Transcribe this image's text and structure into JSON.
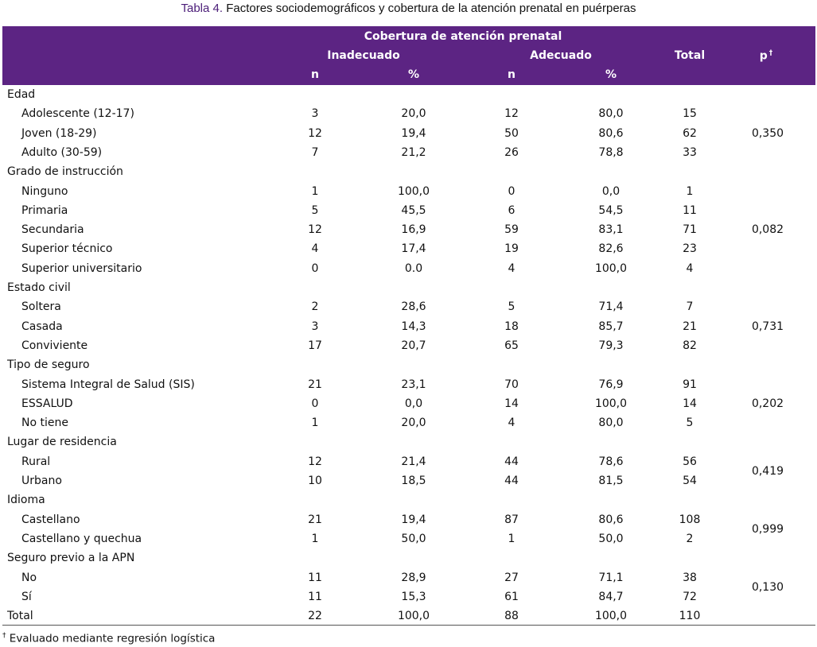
{
  "caption": {
    "label": "Tabla 4.",
    "text": " Factores sociodemográficos y cobertura de la atención prenatal en puérperas"
  },
  "header": {
    "group": "Cobertura de atención prenatal",
    "inadecuado": "Inadecuado",
    "adecuado": "Adecuado",
    "total": "Total",
    "p": "p",
    "p_mark": "†",
    "n": "n",
    "pct": "%"
  },
  "rows": [
    {
      "type": "section",
      "label": "Edad"
    },
    {
      "type": "row",
      "label": "Adolescente (12-17)",
      "n1": "3",
      "p1": "20,0",
      "n2": "12",
      "p2": "80,0",
      "total": "15"
    },
    {
      "type": "row",
      "label": "Joven  (18-29)",
      "n1": "12",
      "p1": "19,4",
      "n2": "50",
      "p2": "80,6",
      "total": "62",
      "pval": "0,350"
    },
    {
      "type": "row",
      "label": "Adulto (30-59)",
      "n1": "7",
      "p1": "21,2",
      "n2": "26",
      "p2": "78,8",
      "total": "33"
    },
    {
      "type": "section",
      "label": "Grado de instrucción"
    },
    {
      "type": "row",
      "label": "Ninguno",
      "n1": "1",
      "p1": "100,0",
      "n2": "0",
      "p2": "0,0",
      "total": "1"
    },
    {
      "type": "row",
      "label": "Primaria",
      "n1": "5",
      "p1": "45,5",
      "n2": "6",
      "p2": "54,5",
      "total": "11"
    },
    {
      "type": "row",
      "label": "Secundaria",
      "n1": "12",
      "p1": "16,9",
      "n2": "59",
      "p2": "83,1",
      "total": "71",
      "pval": "0,082"
    },
    {
      "type": "row",
      "label": "Superior técnico",
      "n1": "4",
      "p1": "17,4",
      "n2": "19",
      "p2": "82,6",
      "total": "23"
    },
    {
      "type": "row",
      "label": "Superior universitario",
      "n1": "0",
      "p1": "0.0",
      "n2": "4",
      "p2": "100,0",
      "total": "4"
    },
    {
      "type": "section",
      "label": "Estado civil"
    },
    {
      "type": "row",
      "label": "Soltera",
      "n1": "2",
      "p1": "28,6",
      "n2": "5",
      "p2": "71,4",
      "total": "7"
    },
    {
      "type": "row",
      "label": "Casada",
      "n1": "3",
      "p1": "14,3",
      "n2": "18",
      "p2": "85,7",
      "total": "21",
      "pval": "0,731"
    },
    {
      "type": "row",
      "label": "Conviviente",
      "n1": "17",
      "p1": "20,7",
      "n2": "65",
      "p2": "79,3",
      "total": "82"
    },
    {
      "type": "section",
      "label": "Tipo de seguro"
    },
    {
      "type": "row",
      "label": "Sistema Integral de Salud (SIS)",
      "n1": "21",
      "p1": "23,1",
      "n2": "70",
      "p2": "76,9",
      "total": "91"
    },
    {
      "type": "row",
      "label": "ESSALUD",
      "n1": "0",
      "p1": "0,0",
      "n2": "14",
      "p2": "100,0",
      "total": "14",
      "pval": "0,202"
    },
    {
      "type": "row",
      "label": "No tiene",
      "n1": "1",
      "p1": "20,0",
      "n2": "4",
      "p2": "80,0",
      "total": "5"
    },
    {
      "type": "section",
      "label": "Lugar de residencia"
    },
    {
      "type": "row",
      "label": "Rural",
      "n1": "12",
      "p1": "21,4",
      "n2": "44",
      "p2": "78,6",
      "total": "56"
    },
    {
      "type": "row",
      "label": "Urbano",
      "n1": "10",
      "p1": "18,5",
      "n2": "44",
      "p2": "81,5",
      "total": "54"
    },
    {
      "type": "section",
      "label": "Idioma"
    },
    {
      "type": "row",
      "label": "Castellano",
      "n1": "21",
      "p1": "19,4",
      "n2": "87",
      "p2": "80,6",
      "total": "108"
    },
    {
      "type": "row",
      "label": "Castellano y quechua",
      "n1": "1",
      "p1": "50,0",
      "n2": "1",
      "p2": "50,0",
      "total": "2"
    },
    {
      "type": "section",
      "label": "Seguro previo a la APN"
    },
    {
      "type": "row",
      "label": "No",
      "n1": "11",
      "p1": "28,9",
      "n2": "27",
      "p2": "71,1",
      "total": "38"
    },
    {
      "type": "row",
      "label": "Sí",
      "n1": "11",
      "p1": "15,3",
      "n2": "61",
      "p2": "84,7",
      "total": "72"
    },
    {
      "type": "total",
      "label": "Total",
      "n1": "22",
      "p1": "100,0",
      "n2": "88",
      "p2": "100,0",
      "total": "110"
    }
  ],
  "pair_pvalues": [
    {
      "after_row": "Rural",
      "value": "0,419"
    },
    {
      "after_row": "Castellano",
      "value": "0,999"
    },
    {
      "after_row": "No",
      "value": "0,130"
    }
  ],
  "footnote": {
    "mark": "†",
    "text": " Evaluado mediante regresión logística"
  },
  "colors": {
    "header_bg": "#5c2483",
    "caption_label": "#4b1d78"
  }
}
